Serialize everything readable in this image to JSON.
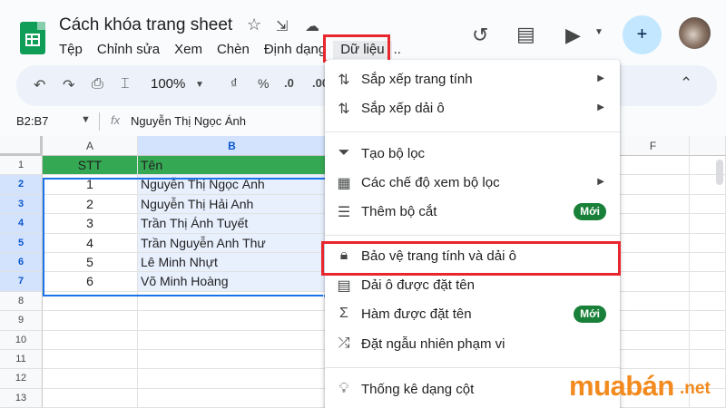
{
  "document": {
    "title": "Cách khóa trang sheet"
  },
  "menubar": [
    {
      "label": "Tệp"
    },
    {
      "label": "Chỉnh sửa"
    },
    {
      "label": "Xem"
    },
    {
      "label": "Chèn"
    },
    {
      "label": "Định dạng"
    },
    {
      "label": "Dữ liệu"
    }
  ],
  "menubar_more": "..",
  "toolbar": {
    "zoom": "100%",
    "currency": "₫",
    "percent": "%",
    "decimal_decrease": ".0",
    "decimal_increase": ".00"
  },
  "formula_bar": {
    "name_box": "B2:B7",
    "fx": "fx",
    "content": "Nguyễn Thị Ngọc Ánh"
  },
  "columns": [
    "A",
    "B",
    "F"
  ],
  "rows": [
    "1",
    "2",
    "3",
    "4",
    "5",
    "6",
    "7",
    "8",
    "9",
    "10",
    "11",
    "12",
    "13"
  ],
  "table": {
    "headers": [
      "STT",
      "Tên"
    ],
    "rows": [
      {
        "stt": "1",
        "name": "Nguyễn Thị Ngọc Ánh"
      },
      {
        "stt": "2",
        "name": "Nguyễn Thị Hải Anh"
      },
      {
        "stt": "3",
        "name": "Trần Thị Ánh Tuyết"
      },
      {
        "stt": "4",
        "name": "Trần Nguyễn Anh Thư"
      },
      {
        "stt": "5",
        "name": "Lê Minh Nhựt"
      },
      {
        "stt": "6",
        "name": "Võ Minh Hoàng"
      }
    ]
  },
  "data_menu": {
    "items": [
      {
        "label": "Sắp xếp trang tính",
        "icon": "sort-icon",
        "submenu": true
      },
      {
        "label": "Sắp xếp dải ô",
        "icon": "sort-range-icon",
        "submenu": true
      },
      {
        "label": "Tạo bộ lọc",
        "icon": "filter-icon"
      },
      {
        "label": "Các chế độ xem bộ lọc",
        "icon": "filter-views-icon",
        "submenu": true
      },
      {
        "label": "Thêm bộ cắt",
        "icon": "slicer-icon",
        "badge": "Mới"
      },
      {
        "label": "Bảo vệ trang tính và dải ô",
        "icon": "lock-icon"
      },
      {
        "label": "Dải ô được đặt tên",
        "icon": "named-range-icon"
      },
      {
        "label": "Hàm được đặt tên",
        "icon": "sigma-icon",
        "badge": "Mới"
      },
      {
        "label": "Đặt ngẫu nhiên phạm vi",
        "icon": "shuffle-icon"
      },
      {
        "label": "Thống kê dạng cột",
        "icon": "lightbulb-icon"
      }
    ]
  },
  "watermark": {
    "brand": "muabán",
    "tld": ".net"
  },
  "colors": {
    "highlight": "#e8262d",
    "header_row": "#34a853",
    "selection": "#1a73e8",
    "badge": "#188038",
    "watermark": "#f28a1e"
  }
}
